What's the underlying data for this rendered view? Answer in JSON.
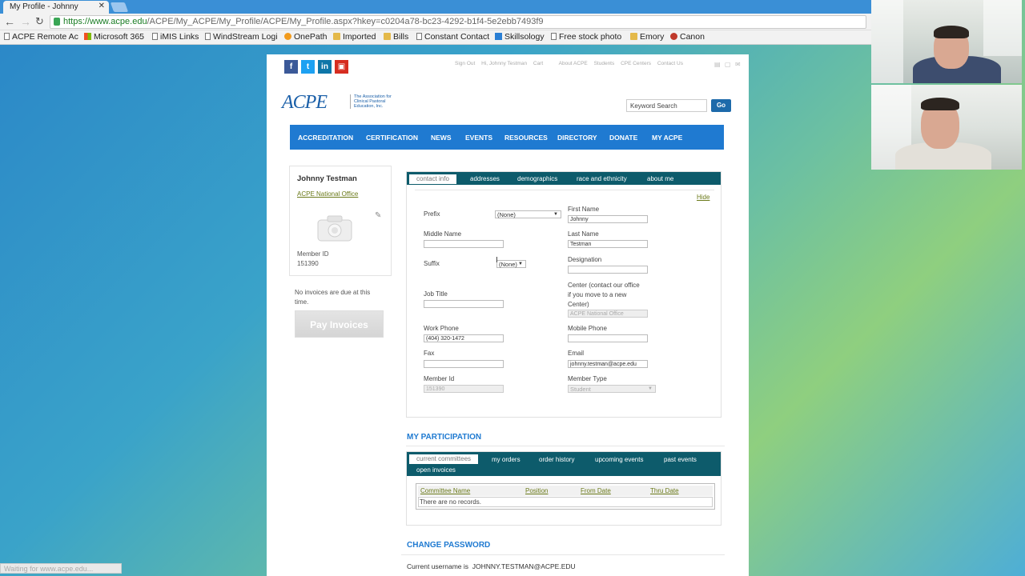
{
  "browser": {
    "tab_title": "My Profile - Johnny",
    "url_host": "https://www.acpe.edu",
    "url_path": "/ACPE/My_ACPE/My_Profile/ACPE/My_Profile.aspx?hkey=c0204a78-bc23-4292-b1f4-5e2ebb7493f9",
    "bookmarks": [
      "ACPE Remote Ac",
      "Microsoft 365",
      "iMIS Links",
      "WindStream Logi",
      "OnePath",
      "Imported",
      "Bills",
      "Constant Contact",
      "Skillsology",
      "Free stock photo",
      "Emory",
      "Canon"
    ],
    "status": "Waiting for www.acpe.edu..."
  },
  "header": {
    "social": [
      "f",
      "t",
      "in",
      "▣"
    ],
    "top_links": [
      "Sign Out",
      "Hi, Johnny Testman",
      "Cart",
      "About ACPE",
      "Students",
      "CPE Centers",
      "Contact Us"
    ],
    "logo": "ACPE",
    "logo_sub": "The Association for Clinical Pastoral Education, Inc.",
    "search_placeholder": "Keyword Search",
    "go": "Go"
  },
  "nav": [
    "ACCREDITATION",
    "CERTIFICATION",
    "NEWS",
    "EVENTS",
    "RESOURCES",
    "DIRECTORY",
    "DONATE",
    "MY ACPE"
  ],
  "profile": {
    "name": "Johnny Testman",
    "office": "ACPE National Office",
    "member_id_label": "Member ID",
    "member_id": "151390",
    "invoice_note": "No invoices are due at this time.",
    "pay_button": "Pay Invoices"
  },
  "contact": {
    "tabs": [
      "contact info",
      "addresses",
      "demographics",
      "race and ethnicity",
      "about me"
    ],
    "hide": "Hide",
    "prefix_label": "Prefix",
    "prefix_value": "(None)",
    "middle_label": "Middle Name",
    "middle_value": "",
    "suffix_label": "Suffix",
    "suffix_value": "(None)",
    "job_label": "Job Title",
    "job_value": "",
    "work_phone_label": "Work Phone",
    "work_phone_value": "(404) 320-1472",
    "fax_label": "Fax",
    "fax_value": "",
    "member_id_label": "Member Id",
    "member_id_value": "151390",
    "first_label": "First Name",
    "first_value": "Johnny",
    "last_label": "Last Name",
    "last_value": "Testman",
    "designation_label": "Designation",
    "designation_value": "",
    "center_label": "Center (contact our office if you move to a new Center)",
    "center_value": "ACPE National Office",
    "mobile_label": "Mobile Phone",
    "mobile_value": "",
    "email_label": "Email",
    "email_value": "johnny.testman@acpe.edu",
    "member_type_label": "Member Type",
    "member_type_value": "Student"
  },
  "participation": {
    "title": "MY PARTICIPATION",
    "tabs": [
      "current committees",
      "my orders",
      "order history",
      "upcoming events",
      "past events",
      "open invoices"
    ],
    "columns": [
      "Committee Name",
      "Position",
      "From Date",
      "Thru Date"
    ],
    "empty": "There are no records."
  },
  "password": {
    "title": "CHANGE PASSWORD",
    "username_label": "Current username is",
    "username": "JOHNNY.TESTMAN@ACPE.EDU"
  },
  "colors": {
    "nav_blue": "#1f7ad1",
    "tab_teal": "#0d5b6b",
    "link_olive": "#6b7a1a"
  }
}
